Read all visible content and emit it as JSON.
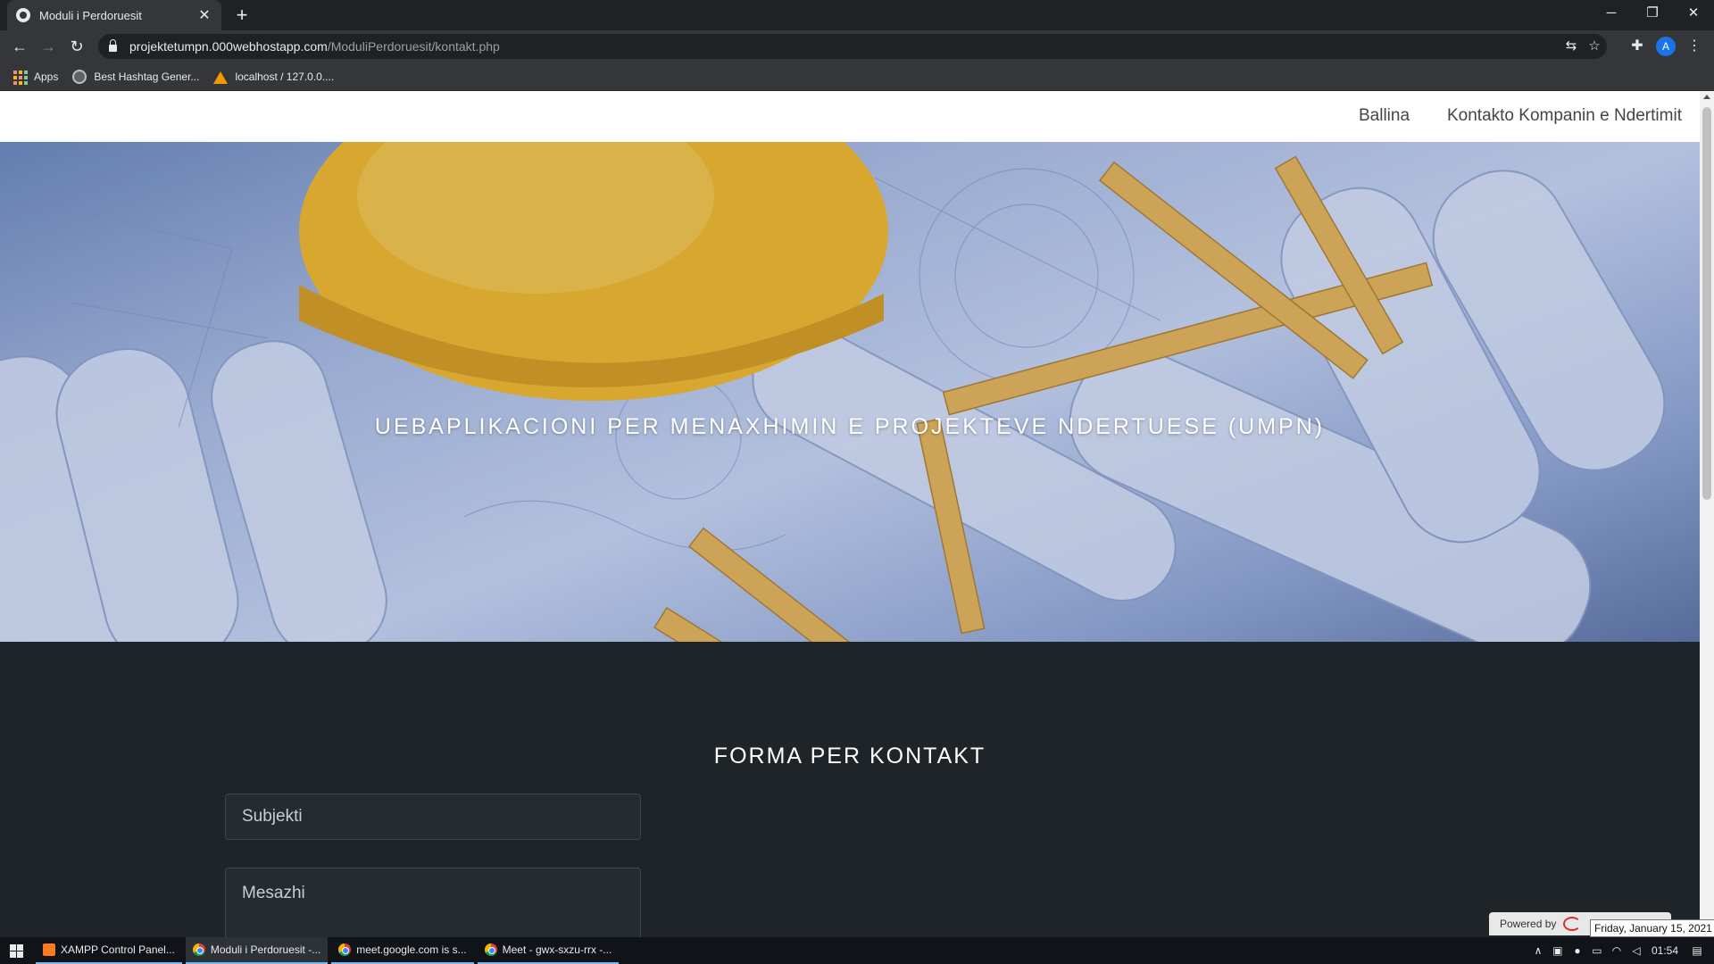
{
  "browser": {
    "tab_title": "Moduli i Perdoruesit",
    "url_host": "projektetumpn.000webhostapp.com",
    "url_path": "/ModuliPerdoruesit/kontakt.php",
    "bookmarks": [
      {
        "label": "Apps",
        "icon": "apps-grid-icon"
      },
      {
        "label": "Best Hashtag Gener...",
        "icon": "hashtag-site-icon"
      },
      {
        "label": "localhost / 127.0.0....",
        "icon": "phpmyadmin-icon"
      }
    ],
    "profile_initial": "A"
  },
  "page": {
    "nav": {
      "home": "Ballina",
      "contact": "Kontakto Kompanin e Ndertimit"
    },
    "hero_title": "UEBAPLIKACIONI PER MENAXHIMIN E PROJEKTEVE NDERTUESE (UMPN)",
    "contact": {
      "title": "FORMA PER KONTAKT",
      "subject_placeholder": "Subjekti",
      "message_placeholder": "Mesazhi"
    },
    "powered_by": "Powered by",
    "date_tooltip": "Friday, January 15, 2021"
  },
  "taskbar": {
    "tasks": [
      {
        "label": "XAMPP Control Panel...",
        "icon": "xampp-icon"
      },
      {
        "label": "Moduli i Perdoruesit -...",
        "icon": "chrome-icon"
      },
      {
        "label": "meet.google.com is s...",
        "icon": "chrome-icon"
      },
      {
        "label": "Meet - gwx-sxzu-rrx -...",
        "icon": "chrome-icon"
      }
    ],
    "clock": "01:54"
  },
  "colors": {
    "page_dark_bg": "#1e2428",
    "navbar_bg": "#ffffff",
    "hero_tint": "#a9b9d9",
    "helmet_yellow": "#f2b51e"
  }
}
